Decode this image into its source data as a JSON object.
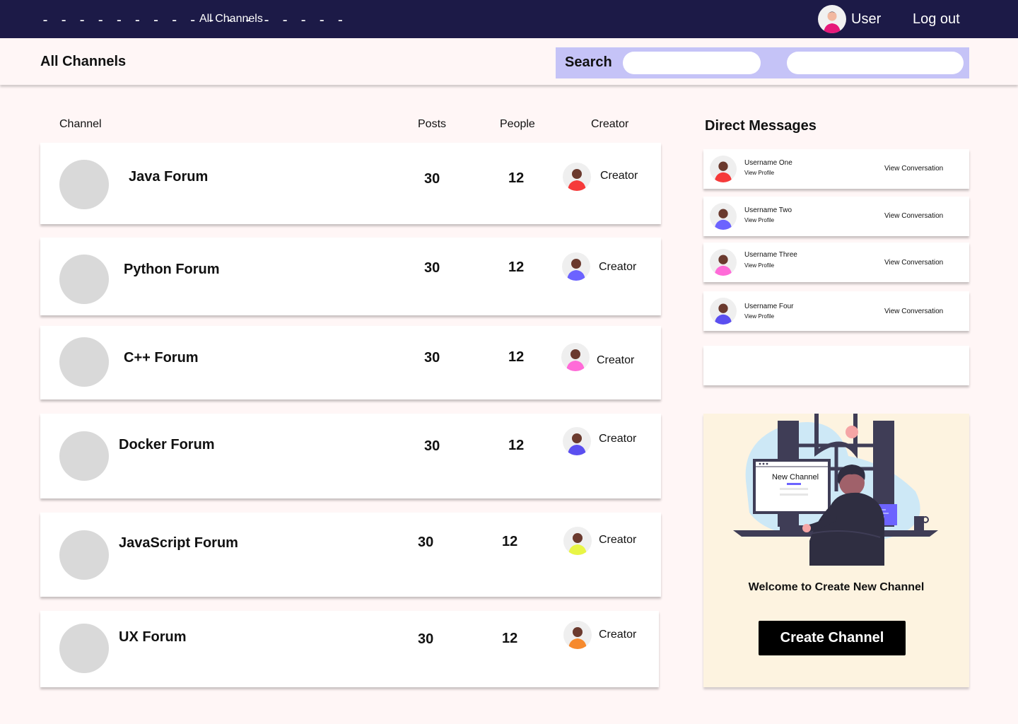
{
  "topbar": {
    "logo": "- - - - - - - - - - - - - - - - -",
    "nav_link": "All Channels",
    "user_label": "User",
    "logout_label": "Log out"
  },
  "header": {
    "title": "All Channels",
    "search_label": "Search",
    "search_input_1": "",
    "search_input_2": ""
  },
  "table": {
    "columns": [
      "Channel",
      "Posts",
      "People",
      "Creator"
    ],
    "rows": [
      {
        "name": "Java Forum",
        "posts": "30",
        "people": "12",
        "creator": "Creator",
        "avatar_color": "#f63a3a"
      },
      {
        "name": "Python Forum",
        "posts": "30",
        "people": "12",
        "creator": "Creator",
        "avatar_color": "#6c63ff"
      },
      {
        "name": "C++ Forum",
        "posts": "30",
        "people": "12",
        "creator": "Creator",
        "avatar_color": "#ff6bd8"
      },
      {
        "name": "Docker Forum",
        "posts": "30",
        "people": "12",
        "creator": "Creator",
        "avatar_color": "#5b4ff0"
      },
      {
        "name": "JavaScript Forum",
        "posts": "30",
        "people": "12",
        "creator": "Creator",
        "avatar_color": "#e8f545"
      },
      {
        "name": "UX Forum",
        "posts": "30",
        "people": "12",
        "creator": "Creator",
        "avatar_color": "#f68a2e"
      }
    ]
  },
  "dm": {
    "title": "Direct Messages",
    "items": [
      {
        "name": "Username One",
        "profile": "View Profile",
        "view": "View Conversation",
        "avatar_color": "#f63a3a"
      },
      {
        "name": "Username Two",
        "profile": "View Profile",
        "view": "View Conversation",
        "avatar_color": "#6c63ff"
      },
      {
        "name": "Username Three",
        "profile": "View Profile",
        "view": "View Conversation",
        "avatar_color": "#ff6bd8"
      },
      {
        "name": "Username Four",
        "profile": "View Profile",
        "view": "View Conversation",
        "avatar_color": "#5b4ff0"
      }
    ]
  },
  "create": {
    "illustration_text": "New Channel",
    "welcome": "Welcome to Create New Channel",
    "button_label": "Create Channel"
  },
  "colors": {
    "topbar": "#1c1a47",
    "background": "#fff6f6",
    "search_bg": "#c5c3f7",
    "panel_bg": "#fdf3e0",
    "accent": "#6c63ff"
  }
}
